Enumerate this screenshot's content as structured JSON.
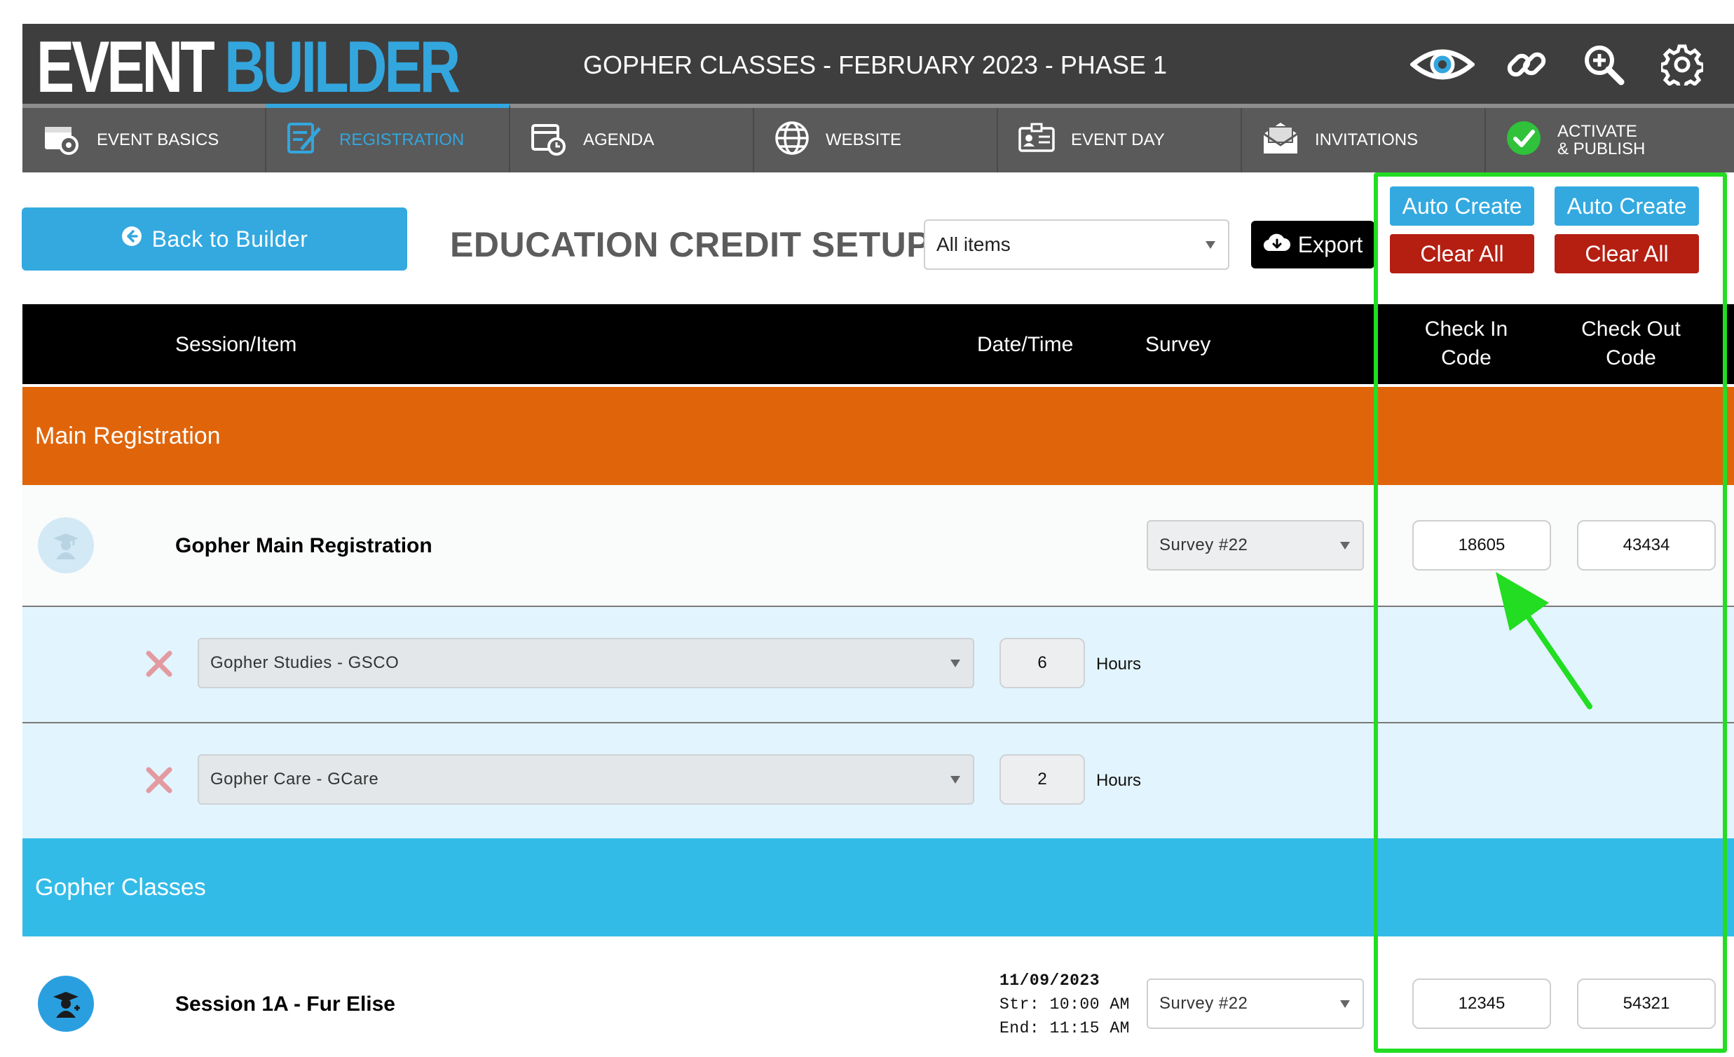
{
  "header": {
    "logo_word1": "EVENT",
    "logo_word2": "BUILDER",
    "event_title": "GOPHER CLASSES - FEBRUARY 2023 - PHASE 1",
    "icons": [
      "eye-icon",
      "link-icon",
      "zoom-in-icon",
      "gear-icon"
    ]
  },
  "nav": {
    "tabs": [
      {
        "label": "EVENT BASICS",
        "icon": "event-settings-icon"
      },
      {
        "label": "REGISTRATION",
        "icon": "edit-form-icon",
        "active": true
      },
      {
        "label": "AGENDA",
        "icon": "calendar-clock-icon"
      },
      {
        "label": "WEBSITE",
        "icon": "globe-icon"
      },
      {
        "label": "EVENT DAY",
        "icon": "badge-icon"
      },
      {
        "label": "INVITATIONS",
        "icon": "envelope-icon"
      },
      {
        "label_line1": "ACTIVATE",
        "label_line2": "& PUBLISH",
        "icon": "check-circle-icon"
      }
    ]
  },
  "toolbar": {
    "back_label": "Back to Builder",
    "page_title": "EDUCATION CREDIT SETUP",
    "filter_value": "All items",
    "export_label": "Export",
    "auto_create_label": "Auto Create",
    "clear_all_label": "Clear All"
  },
  "table": {
    "columns": {
      "session": "Session/Item",
      "datetime": "Date/Time",
      "survey": "Survey",
      "checkin_line1": "Check In",
      "checkin_line2": "Code",
      "checkout_line1": "Check Out",
      "checkout_line2": "Code"
    },
    "sections": [
      {
        "name": "Main Registration",
        "color": "#e0650a",
        "item": {
          "title": "Gopher Main Registration",
          "survey": "Survey #22",
          "checkin": "18605",
          "checkout": "43434",
          "credits": [
            {
              "credit": "Gopher Studies - GSCO",
              "hours": "6",
              "unit": "Hours"
            },
            {
              "credit": "Gopher Care - GCare",
              "hours": "2",
              "unit": "Hours"
            }
          ]
        }
      },
      {
        "name": "Gopher Classes",
        "color": "#33bbe8",
        "item": {
          "title": "Session 1A - Fur Elise",
          "date": "11/09/2023",
          "start": "Str: 10:00 AM",
          "end": "End: 11:15 AM",
          "survey": "Survey #22",
          "checkin": "12345",
          "checkout": "54321"
        }
      }
    ]
  },
  "colors": {
    "accent": "#33a6de",
    "header_bg": "#3e3e3e",
    "nav_bg": "#5a5a5a",
    "danger": "#b41f12",
    "highlight": "#22dd22"
  }
}
